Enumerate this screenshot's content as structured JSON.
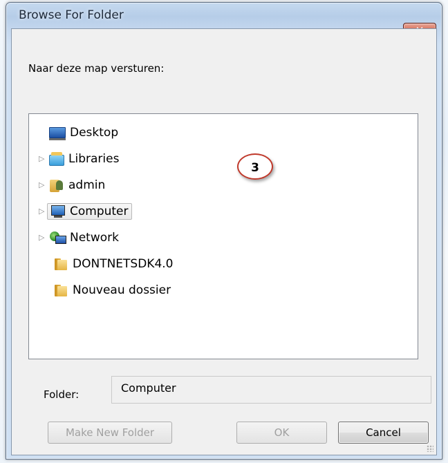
{
  "window": {
    "title": "Browse For Folder",
    "close_label": "✕"
  },
  "instruction": "Naar deze map versturen:",
  "tree": {
    "items": [
      {
        "label": "Desktop",
        "icon": "desktop-icon",
        "expandable": false,
        "selected": false
      },
      {
        "label": "Libraries",
        "icon": "libraries-icon",
        "expandable": true,
        "selected": false
      },
      {
        "label": "admin",
        "icon": "user-folder-icon",
        "expandable": true,
        "selected": false
      },
      {
        "label": "Computer",
        "icon": "computer-icon",
        "expandable": true,
        "selected": true
      },
      {
        "label": "Network",
        "icon": "network-icon",
        "expandable": true,
        "selected": false
      },
      {
        "label": "DONTNETSDK4.0",
        "icon": "folder-icon",
        "expandable": false,
        "selected": false
      },
      {
        "label": "Nouveau dossier",
        "icon": "folder-icon",
        "expandable": false,
        "selected": false
      }
    ]
  },
  "callout": {
    "number": "3",
    "color": "#c0392b"
  },
  "folder": {
    "label": "Folder:",
    "value": "Computer"
  },
  "buttons": {
    "make_new_folder": "Make New Folder",
    "ok": "OK",
    "cancel": "Cancel"
  }
}
